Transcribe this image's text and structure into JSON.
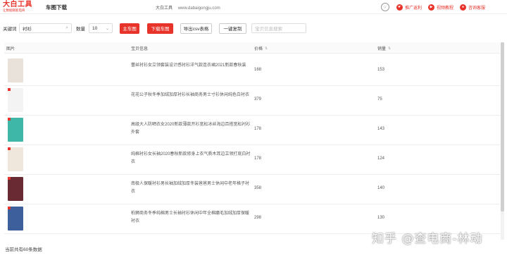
{
  "header": {
    "logo_main": "大白工具",
    "logo_sub": "让数据赋能电商",
    "page_title": "车图下载",
    "site_name": "大白工具",
    "site_url": "www.dabaigongju.com",
    "links": [
      {
        "label": "推广返利",
        "icon": "hand-icon"
      },
      {
        "label": "视频教程",
        "icon": "play-icon"
      },
      {
        "label": "咨询客服",
        "icon": "chat-icon"
      }
    ]
  },
  "toolbar": {
    "keyword_label": "关键词",
    "keyword_value": "衬衫",
    "count_label": "数量",
    "count_value": "10",
    "download_main_label": "主车图",
    "download_all_label": "下载车图",
    "export_csv_label": "导出csv表格",
    "copy_label": "一键复制",
    "filter_placeholder": "宝贝信息搜索"
  },
  "table": {
    "columns": [
      "图片",
      "宝贝信息",
      "价格",
      "销量"
    ],
    "rows": [
      {
        "title": "蕾丝衬衫女立领套装设计感衬衫洋气款连衣裙2021新款春秋装",
        "price": "168",
        "sales": "153",
        "thumb_color": "#e9e2da"
      },
      {
        "title": "花花公子秋冬季加绒加厚衬衫长袖商务男士寸衫休闲纯色白衬衣",
        "price": "379",
        "sales": "75",
        "thumb_color": "#f3f3f3"
      },
      {
        "title": "高级大人防晒衣女2020新款薄款开衫宽松冰丝海边百搭宽松衬衫外套",
        "price": "178",
        "sales": "143",
        "thumb_color": "#3eb7a8"
      },
      {
        "title": "纯棉衬衫女长袖2020春秋新款修身上衣气质木耳边立领打底白衬衣",
        "price": "178",
        "sales": "124",
        "thumb_color": "#efe6dc"
      },
      {
        "title": "南极人保暖衬衫男长袖加绒加厚冬装爸爸男士休闲中老年格子衬衣",
        "price": "358",
        "sales": "140",
        "thumb_color": "#6a2a34"
      },
      {
        "title": "柏狮商务冬季纯棉男士长袖衬衫休闲中年全棉磨毛加绒加厚保暖衬衣",
        "price": "298",
        "sales": "130",
        "thumb_color": "#3d5f9c"
      }
    ]
  },
  "footer": {
    "total_text": "当前共有60条数据"
  },
  "watermark": "知乎 @查电商-林动",
  "colors": {
    "accent": "#e8332a"
  }
}
